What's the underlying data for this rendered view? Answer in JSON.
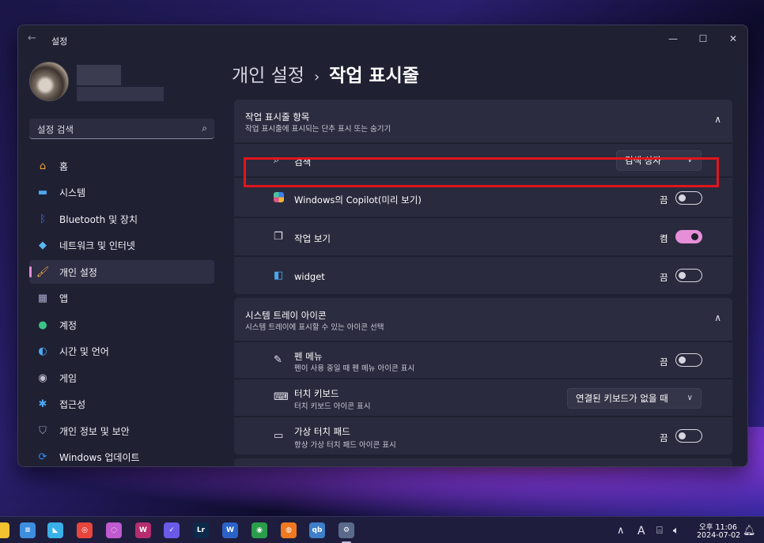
{
  "window": {
    "app_title": "설정",
    "back_glyph": "←",
    "minimize_glyph": "—",
    "maximize_glyph": "☐",
    "close_glyph": "✕"
  },
  "sidebar": {
    "search_placeholder": "설정 검색",
    "search_icon": "⌕",
    "items": [
      {
        "label": "홈",
        "icon": "home-icon",
        "glyph": "⌂",
        "color": "#f2a33a"
      },
      {
        "label": "시스템",
        "icon": "monitor-icon",
        "glyph": "▬",
        "color": "#4aa8f0"
      },
      {
        "label": "Bluetooth 및 장치",
        "icon": "bluetooth-icon",
        "glyph": "ᛒ",
        "color": "#2f7cf0"
      },
      {
        "label": "네트워크 및 인터넷",
        "icon": "wifi-icon",
        "glyph": "◆",
        "color": "#5ab6f4"
      },
      {
        "label": "개인 설정",
        "icon": "brush-icon",
        "glyph": "🖌",
        "color": "#e8a54a"
      },
      {
        "label": "앱",
        "icon": "apps-icon",
        "glyph": "▦",
        "color": "#a8a8c8"
      },
      {
        "label": "계정",
        "icon": "account-icon",
        "glyph": "●",
        "color": "#3bc486"
      },
      {
        "label": "시간 및 언어",
        "icon": "globe-clock-icon",
        "glyph": "◐",
        "color": "#4aa8f0"
      },
      {
        "label": "게임",
        "icon": "gamepad-icon",
        "glyph": "◉",
        "color": "#c0c0d0"
      },
      {
        "label": "접근성",
        "icon": "accessibility-icon",
        "glyph": "✱",
        "color": "#4aa8f0"
      },
      {
        "label": "개인 정보 및 보안",
        "icon": "shield-icon",
        "glyph": "⛉",
        "color": "#9aa0b8"
      },
      {
        "label": "Windows 업데이트",
        "icon": "update-icon",
        "glyph": "⟳",
        "color": "#2f8cf0"
      }
    ],
    "active_index": 4
  },
  "header": {
    "parent": "개인 설정",
    "separator": "›",
    "current": "작업 표시줄"
  },
  "taskbar_items_section": {
    "title": "작업 표시줄 항목",
    "subtitle": "작업 표시줄에 표시되는 단추 표시 또는 숨기기",
    "rows": [
      {
        "label": "검색",
        "icon": "search-icon",
        "control": "dropdown",
        "value": "검색 상자"
      },
      {
        "label": "Windows의 Copilot(미리 보기)",
        "icon": "copilot-icon",
        "control": "toggle",
        "state": "끔",
        "on": false
      },
      {
        "label": "작업 보기",
        "icon": "task-view-icon",
        "control": "toggle",
        "state": "켬",
        "on": true
      },
      {
        "label": "widget",
        "icon": "widgets-icon",
        "control": "toggle",
        "state": "끔",
        "on": false
      }
    ]
  },
  "system_tray_section": {
    "title": "시스템 트레이 아이콘",
    "subtitle": "시스템 트레이에 표시할 수 있는 아이콘 선택",
    "rows": [
      {
        "label": "펜 메뉴",
        "sub": "펜이 사용 중일 때 펜 메뉴 아이콘 표시",
        "icon": "pen-icon",
        "control": "toggle",
        "state": "끔",
        "on": false
      },
      {
        "label": "터치 키보드",
        "sub": "터치 키보드 아이콘 표시",
        "icon": "keyboard-icon",
        "control": "dropdown",
        "value": "연결된 키보드가 없을 때"
      },
      {
        "label": "가상 터치 패드",
        "sub": "항상 가상 터치 패드 아이콘 표시",
        "icon": "touchpad-icon",
        "control": "toggle",
        "state": "끔",
        "on": false
      }
    ]
  },
  "taskbar": {
    "apps": [
      {
        "name": "file-explorer",
        "label": "",
        "color": "#f2c230"
      },
      {
        "name": "notepad",
        "label": "≡",
        "color": "#3e8ee0"
      },
      {
        "name": "store-bird",
        "label": "◣",
        "color": "#3ab0e8"
      },
      {
        "name": "chrome",
        "label": "◎",
        "color": "#e8453c"
      },
      {
        "name": "copilot",
        "label": "◌",
        "color": "#c05ad0"
      },
      {
        "name": "sheet-app",
        "label": "W",
        "color": "#b52d6e"
      },
      {
        "name": "todo",
        "label": "✓",
        "color": "#6a5ae8"
      },
      {
        "name": "lightroom",
        "label": "Lr",
        "color": "#0c2a4a"
      },
      {
        "name": "word",
        "label": "W",
        "color": "#2b62c8"
      },
      {
        "name": "green-app",
        "label": "◉",
        "color": "#2a9d4a"
      },
      {
        "name": "firefox",
        "label": "◍",
        "color": "#f07820"
      },
      {
        "name": "qb",
        "label": "qb",
        "color": "#3f7ec8"
      },
      {
        "name": "settings",
        "label": "⚙",
        "color": "#5a6a8a"
      }
    ],
    "tray_chevron": "∧",
    "tray_ime": "A",
    "clock_time": "오후 11:06",
    "clock_date": "2024-07-02"
  }
}
